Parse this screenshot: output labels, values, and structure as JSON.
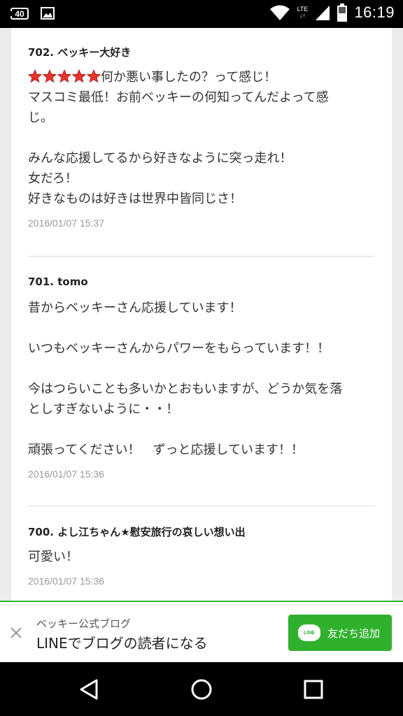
{
  "status_bar": {
    "time": "16:19",
    "network": "LTE",
    "notification_badge": "40",
    "icons": [
      "notification-icon",
      "image-icon",
      "wifi-icon",
      "signal-icon",
      "battery-icon"
    ]
  },
  "comments": [
    {
      "header": "702.  ベッキー大好き",
      "rating": 5,
      "lines": [
        "何か悪い事したの？って感じ！",
        "マスコミ最低！お前ベッキーの何知ってんだよって感",
        "じ。",
        "",
        "みんな応援してるから好きなように突っ走れ！",
        "女だろ！",
        "好きなものは好きは世界中皆同じさ！"
      ],
      "date": "2016/01/07 15:37"
    },
    {
      "header": "701.  tomo",
      "lines": [
        "昔からベッキーさん応援しています！",
        "",
        "いつもベッキーさんからパワーをもらっています！！",
        "",
        "今はつらいことも多いかとおもいますが、どうか気を落",
        "としすぎないように・・！",
        "",
        "頑張ってください！　ずっと応援しています！！"
      ],
      "date": "2016/01/07 15:36"
    },
    {
      "header": "700.  よし江ちゃん★慰安旅行の哀しい想い出",
      "lines": [
        "可愛い！"
      ],
      "date": "2016/01/07 15:36"
    }
  ],
  "banner": {
    "subtitle": "ベッキー公式ブログ",
    "title": "LINEでブログの読者になる",
    "button_label": "友だち追加",
    "logo_text": "LINE",
    "accent_color": "#2fb12d"
  },
  "nav": {
    "icons": [
      "back-icon",
      "home-icon",
      "recents-icon"
    ]
  }
}
